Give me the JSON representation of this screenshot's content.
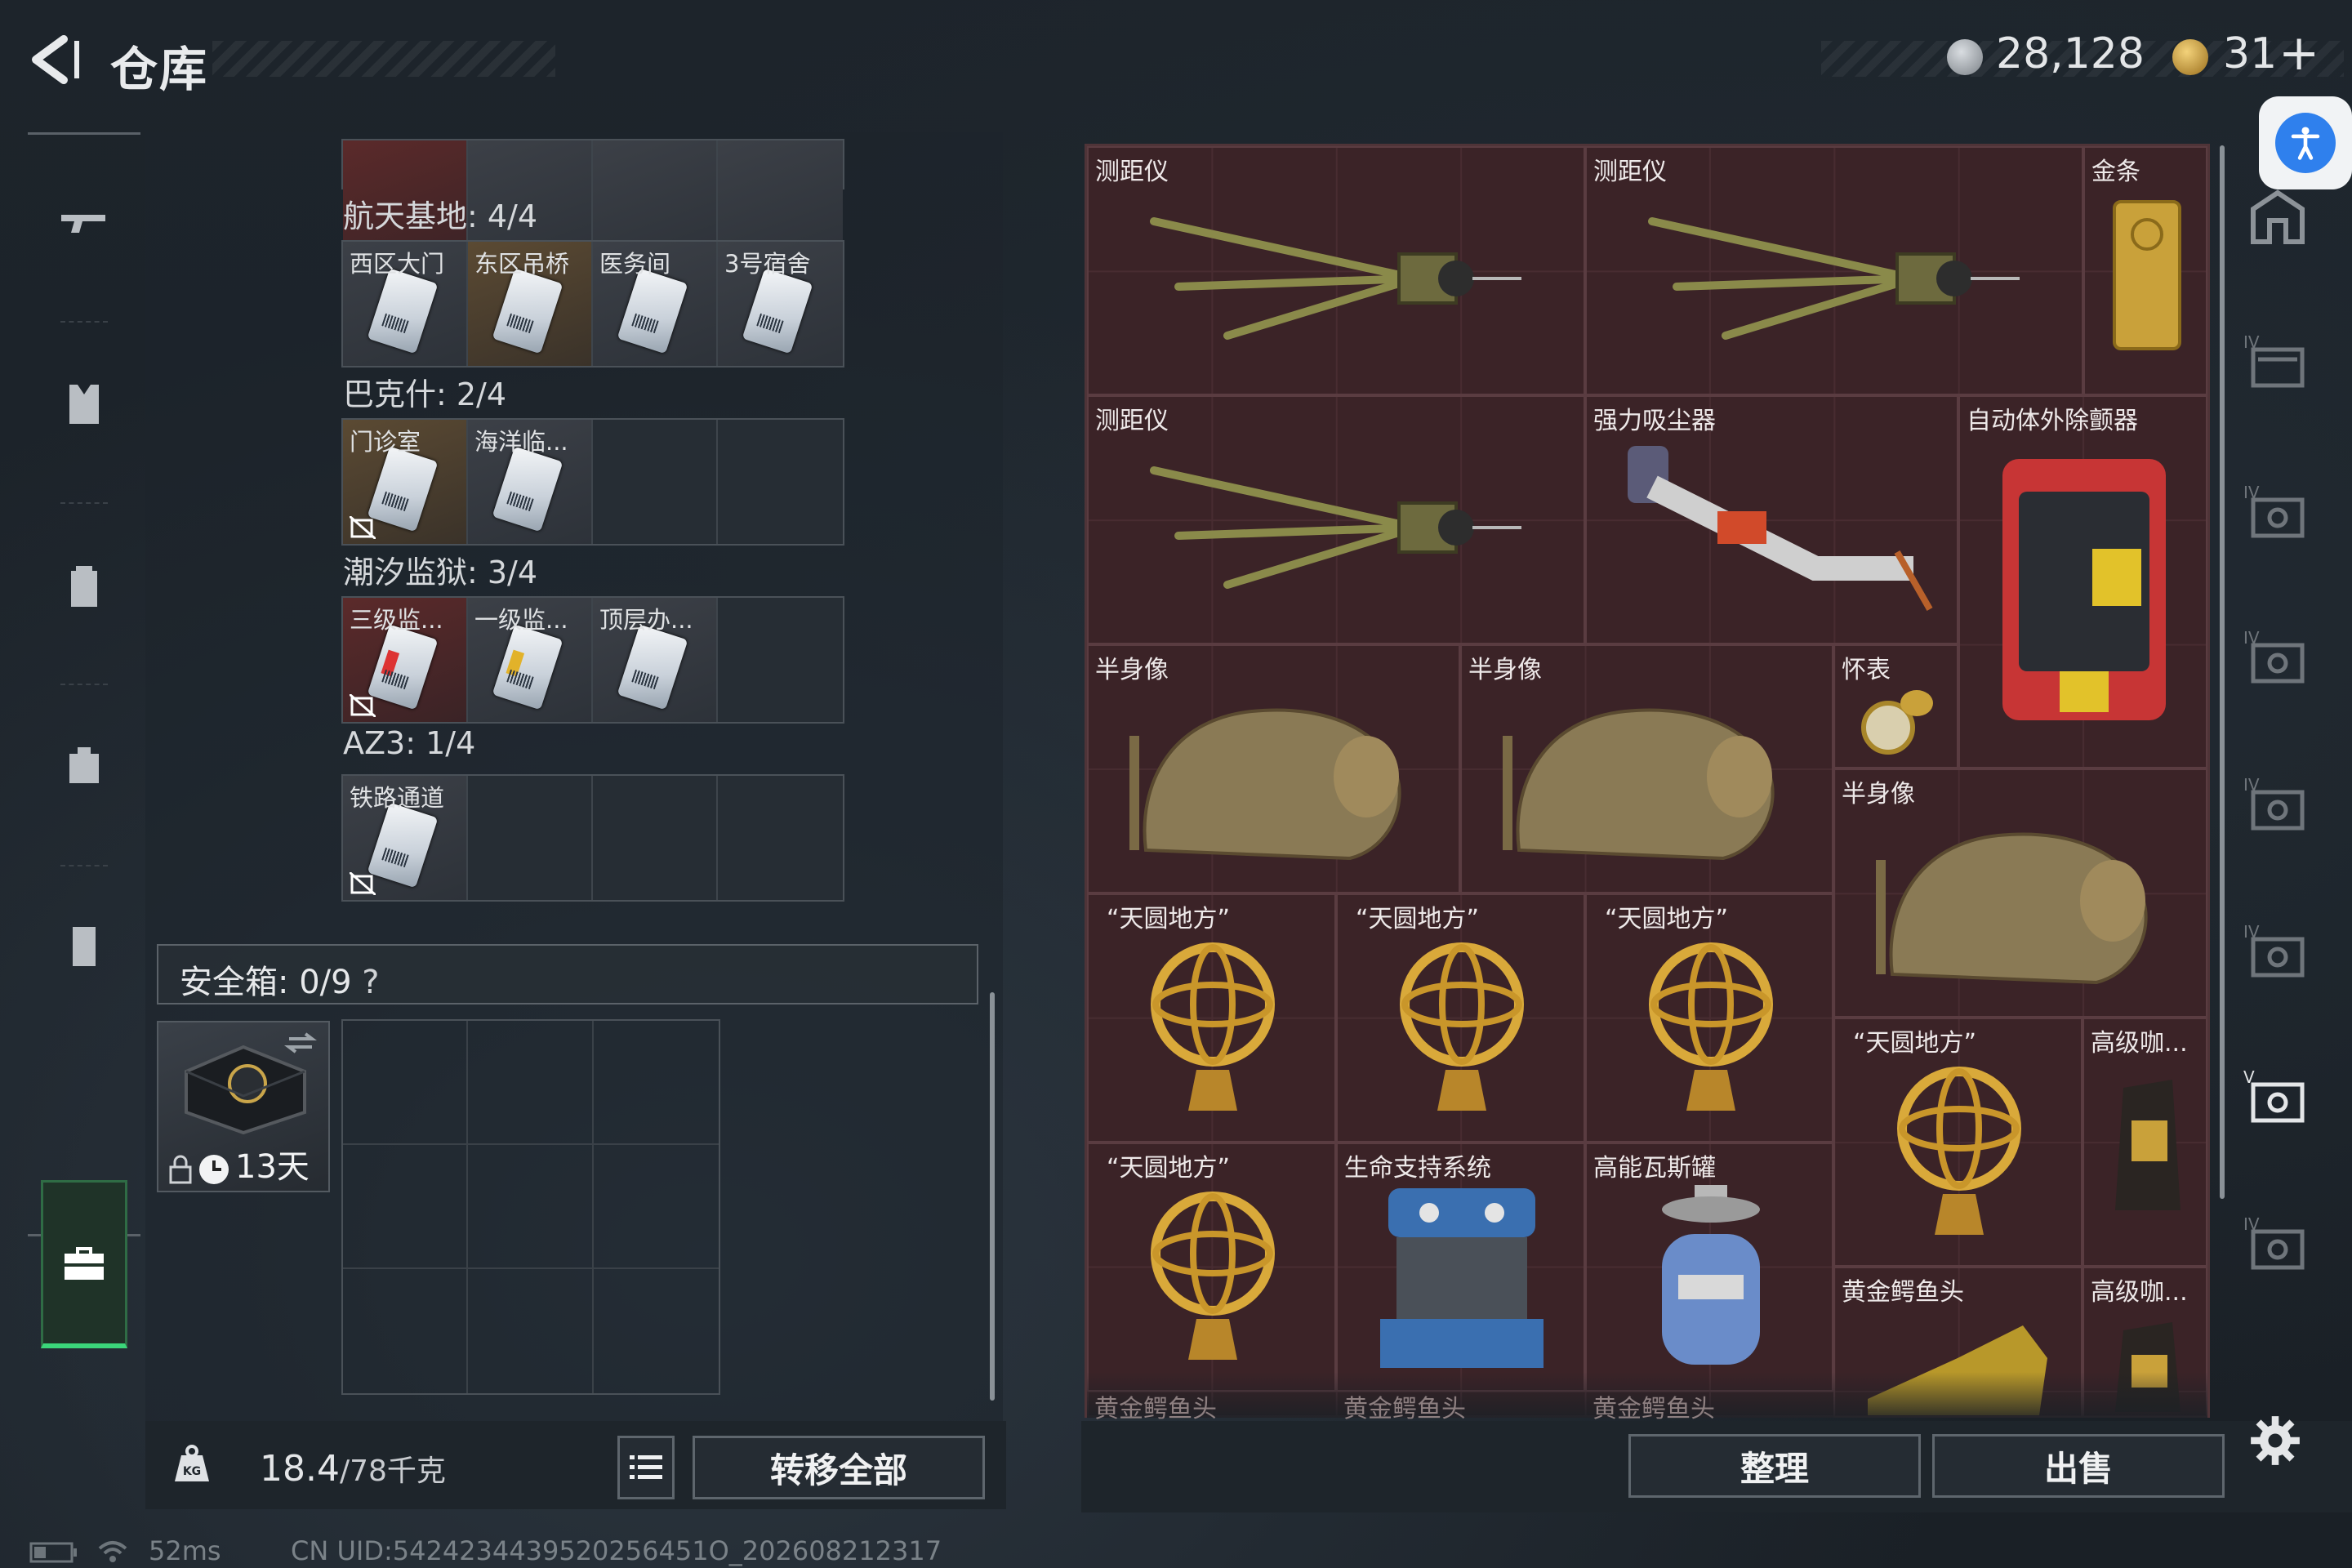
{
  "header": {
    "title": "仓库",
    "currency1": "28,128",
    "currency2": "31",
    "add_symbol": "+"
  },
  "colors": {
    "accent_green": "#3bd67a",
    "stash_bg": "#3a2327",
    "panel_bg": "#1e252b"
  },
  "keycards": {
    "groups": [
      {
        "label": "航天基地: 4/4",
        "cards": [
          "西区大门",
          "东区吊桥",
          "医务间",
          "3号宿舍"
        ]
      },
      {
        "label": "巴克什: 2/4",
        "cards": [
          "门诊室",
          "海洋临...",
          "",
          ""
        ]
      },
      {
        "label": "潮汐监狱: 3/4",
        "cards": [
          "三级监...",
          "一级监...",
          "顶层办...",
          ""
        ]
      },
      {
        "label": "AZ3: 1/4",
        "cards": [
          "铁路通道",
          "",
          "",
          ""
        ]
      }
    ]
  },
  "safe_box": {
    "label": "安全箱: 0/9",
    "help": "?",
    "timer": "13天"
  },
  "bottom_left": {
    "weight_value": "18.4",
    "weight_total": "/78千克",
    "transfer_all": "转移全部"
  },
  "bottom_right": {
    "organize": "整理",
    "sell": "出售"
  },
  "stash_items": [
    {
      "name": "测距仪"
    },
    {
      "name": "测距仪"
    },
    {
      "name": "金条"
    },
    {
      "name": "测距仪"
    },
    {
      "name": "强力吸尘器"
    },
    {
      "name": "自动体外除颤器"
    },
    {
      "name": "半身像"
    },
    {
      "name": "半身像"
    },
    {
      "name": "怀表"
    },
    {
      "name": "半身像"
    },
    {
      "name": "“天圆地方”"
    },
    {
      "name": "“天圆地方”"
    },
    {
      "name": "“天圆地方”"
    },
    {
      "name": "“天圆地方”"
    },
    {
      "name": "高级咖..."
    },
    {
      "name": "“天圆地方”"
    },
    {
      "name": "生命支持系统"
    },
    {
      "name": "高能瓦斯罐"
    },
    {
      "name": "黄金鳄鱼头"
    },
    {
      "name": "高级咖..."
    },
    {
      "name": "黄金鳄鱼头"
    },
    {
      "name": "黄金鳄鱼头"
    },
    {
      "name": "黄金鳄鱼头"
    }
  ],
  "status_bar": {
    "ping": "52ms",
    "uid": "CN UID:5424234439520256451O_202608212317"
  },
  "right_icons": [
    "IV",
    "IV",
    "IV",
    "IV",
    "IV",
    "V",
    "IV"
  ]
}
